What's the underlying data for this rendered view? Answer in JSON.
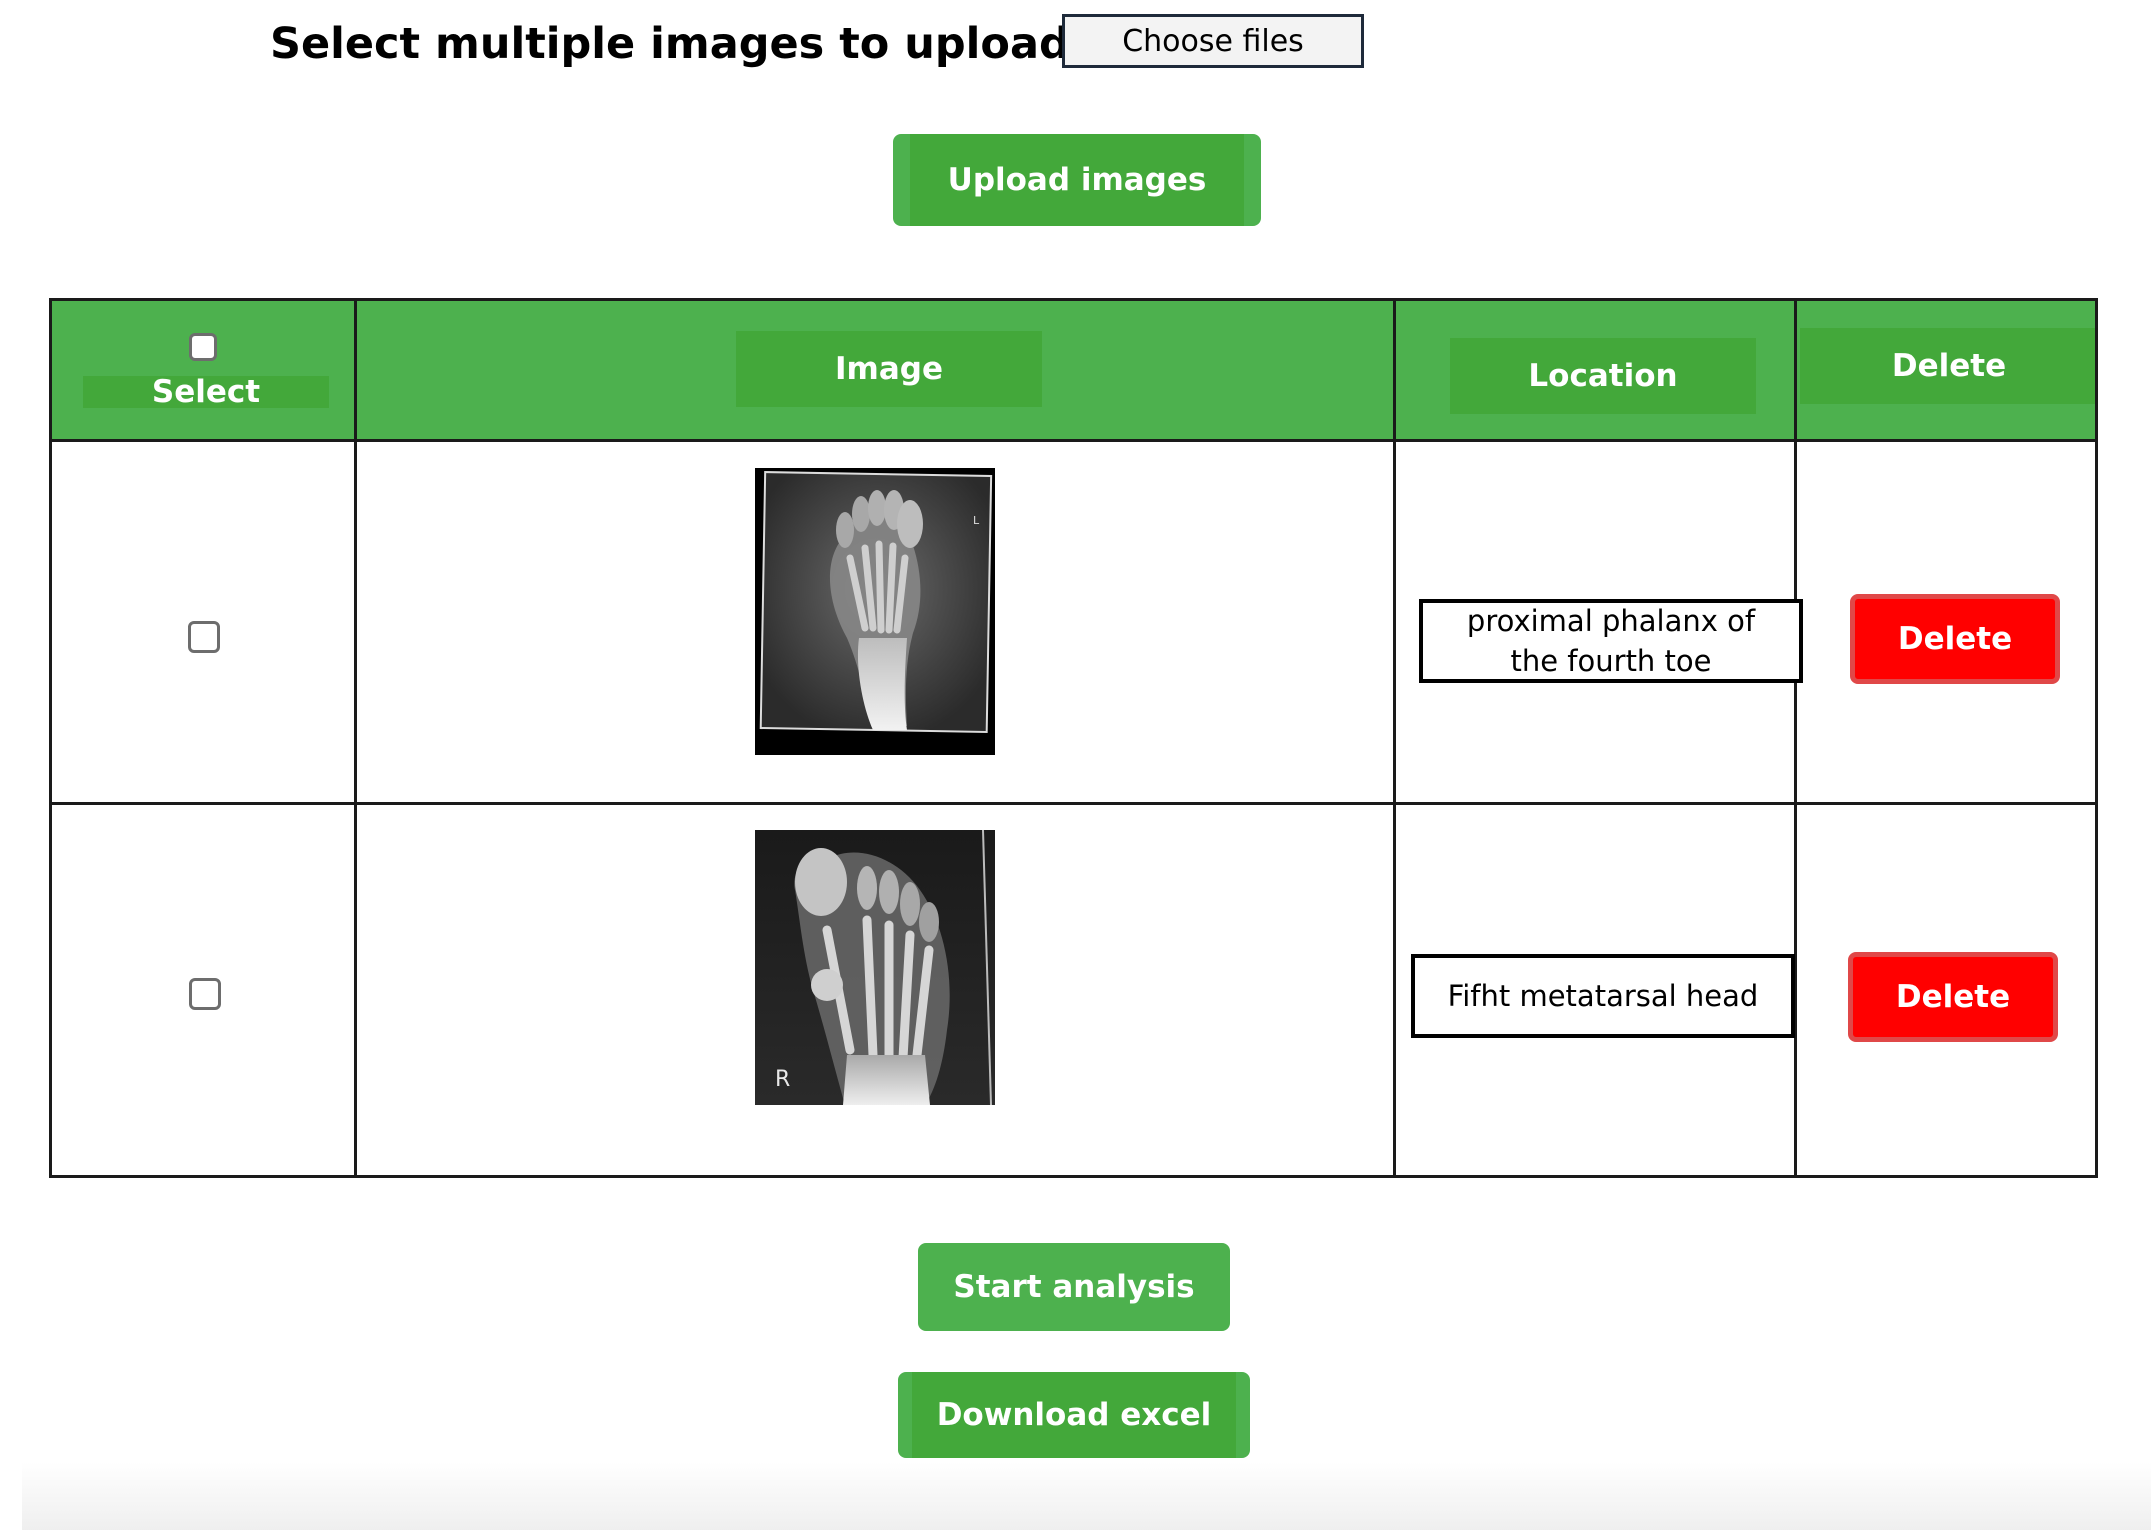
{
  "upload": {
    "title": "Select multiple images to upload:",
    "choose_files": "Choose files",
    "upload_button": "Upload images"
  },
  "table": {
    "headers": {
      "select": "Select",
      "image": "Image",
      "location": "Location",
      "delete": "Delete"
    },
    "rows": [
      {
        "location_line1": "proximal phalanx of",
        "location_line2": "the fourth toe",
        "delete_label": "Delete",
        "marker": "L"
      },
      {
        "location": "Fifht metatarsal head",
        "delete_label": "Delete",
        "marker": "R"
      }
    ]
  },
  "actions": {
    "start": "Start analysis",
    "download": "Download excel"
  },
  "colors": {
    "green": "#4db14e",
    "green_dark": "#43a83a",
    "delete_red": "#ff0000"
  }
}
